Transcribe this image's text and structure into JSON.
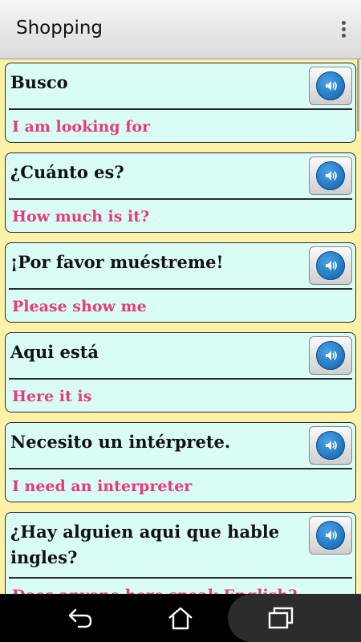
{
  "header": {
    "title": "Shopping"
  },
  "phrases": [
    {
      "phrase": "Busco",
      "translation": "I am looking for"
    },
    {
      "phrase": "¿Cuánto es?",
      "translation": "How much is it?"
    },
    {
      "phrase": "¡Por favor muéstreme!",
      "translation": "Please show me"
    },
    {
      "phrase": "Aqui está",
      "translation": "Here it is"
    },
    {
      "phrase": "Necesito un intérprete.",
      "translation": "I need an interpreter"
    },
    {
      "phrase": "¿Hay alguien aqui que hable ingles?",
      "translation": "Does anyone here speak English?"
    }
  ],
  "icons": {
    "overflow": "more-vert-icon",
    "speak": "speaker-icon",
    "back": "back-icon",
    "home": "home-icon",
    "recents": "recents-icon"
  },
  "colors": {
    "background": "#fdf2a7",
    "card": "#d9fdf6",
    "translation": "#e63b7a",
    "speaker": "#0d5fa9"
  }
}
